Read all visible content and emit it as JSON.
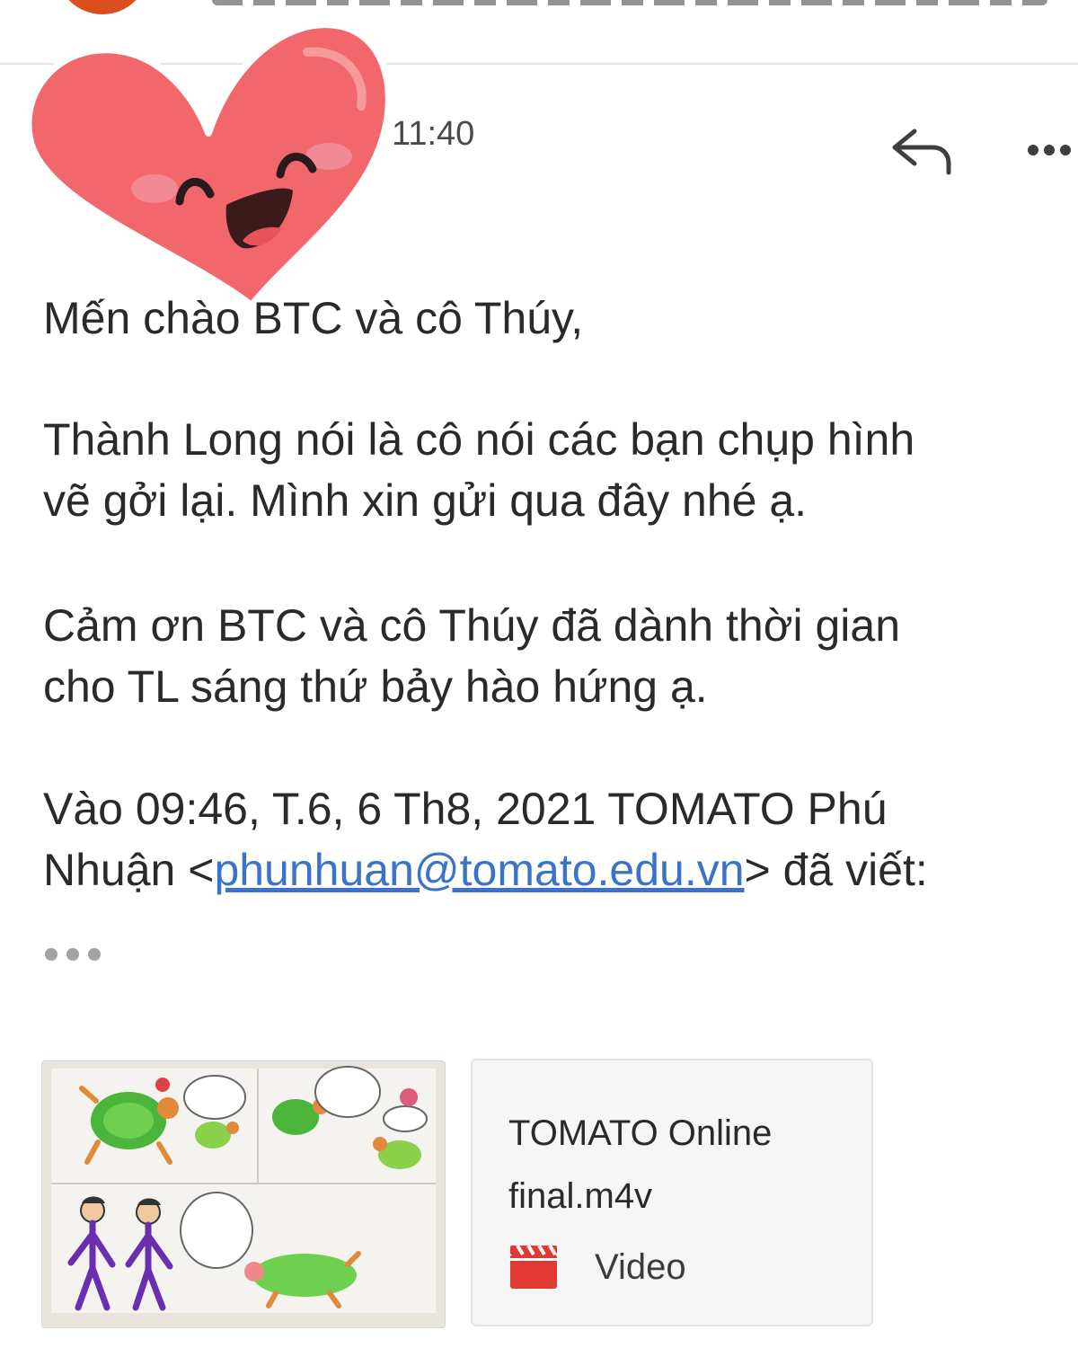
{
  "email": {
    "time": "11:40",
    "greeting": "Mến chào BTC và cô Thúy,",
    "paragraph1": [
      "Thành Long nói là cô nói các bạn chụp hình",
      "vẽ gởi lại. Mình xin gửi qua đây nhé ạ."
    ],
    "paragraph2": [
      "Cảm ơn BTC và cô Thúy đã dành thời gian",
      "cho TL sáng thứ bảy hào hứng ạ."
    ],
    "quote": {
      "line1": "Vào 09:46, T.6, 6 Th8, 2021 TOMATO Phú",
      "line2_prefix": "Nhuận <",
      "email": "phunhuan@tomato.edu.vn",
      "line2_suffix": "> đã viết:"
    }
  },
  "attachments": {
    "video": {
      "filename": "TOMATO Online\nfinal.m4v",
      "type_label": "Video",
      "icon": "video-clapper-icon",
      "icon_color": "#e03a32"
    },
    "image": {
      "kind": "children's drawing of turtles and two boys"
    }
  },
  "icons": {
    "reply": "reply-icon",
    "more": "more-options-icon",
    "expand": "show-quoted-text-dots",
    "sticker": "smiling-heart-sticker"
  },
  "colors": {
    "link": "#3a73c9",
    "heart": "#f2676b",
    "avatar": "#d9501e"
  }
}
